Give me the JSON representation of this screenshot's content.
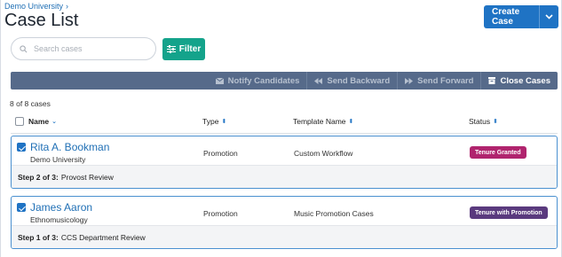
{
  "breadcrumb": {
    "parent": "Demo University",
    "separator": "›"
  },
  "page_title": "Case List",
  "create_button": {
    "label": "Create Case"
  },
  "search": {
    "placeholder": "Search cases"
  },
  "filter_button": {
    "label": "Filter"
  },
  "actions": [
    {
      "label": "Notify Candidates",
      "icon": "envelope-icon",
      "enabled": false
    },
    {
      "label": "Send Backward",
      "icon": "rewind-icon",
      "enabled": false
    },
    {
      "label": "Send Forward",
      "icon": "fast-forward-icon",
      "enabled": false
    },
    {
      "label": "Close Cases",
      "icon": "archive-box-icon",
      "enabled": true
    }
  ],
  "count_text": "8 of 8 cases",
  "columns": {
    "name": "Name",
    "type": "Type",
    "template": "Template Name",
    "status": "Status"
  },
  "rows": [
    {
      "name": "Rita A. Bookman",
      "sub": "Demo University",
      "type": "Promotion",
      "template": "Custom Workflow",
      "status": "Tenure Granted",
      "status_color": "#b0246e",
      "step_label": "Step 2 of 3:",
      "step_name": "Provost Review",
      "checked": true
    },
    {
      "name": "James Aaron",
      "sub": "Ethnomusicology",
      "type": "Promotion",
      "template": "Music Promotion Cases",
      "status": "Tenure with Promotion",
      "status_color": "#5a3a7e",
      "step_label": "Step 1 of 3:",
      "step_name": "CCS Department Review",
      "checked": true
    }
  ],
  "colors": {
    "primary": "#1f73c4",
    "filter": "#14a38b",
    "actionbar": "#566a8a"
  }
}
